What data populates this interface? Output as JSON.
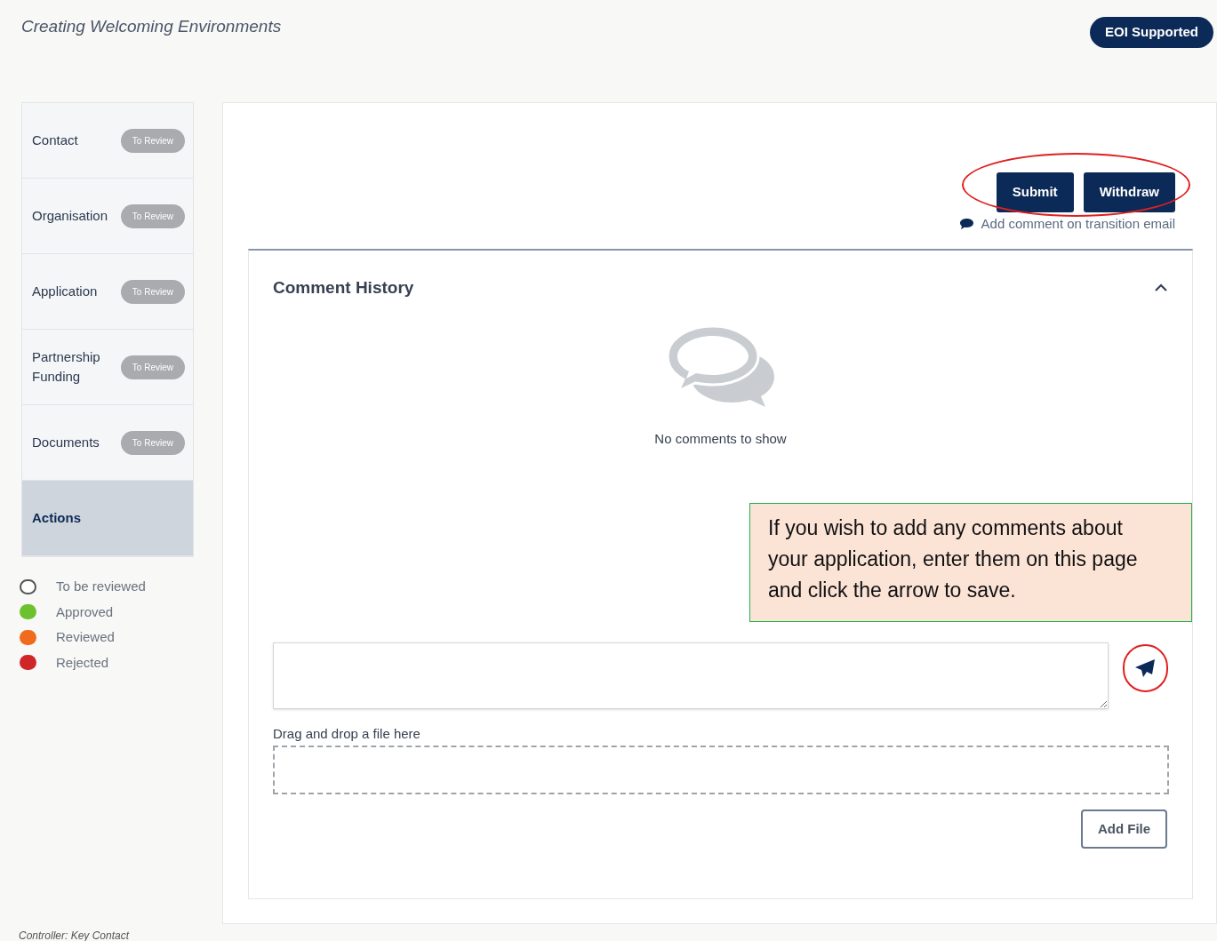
{
  "header": {
    "title": "Creating Welcoming Environments",
    "status_badge": "EOI Supported"
  },
  "sidebar": {
    "items": [
      {
        "label": "Contact",
        "badge": "To Review",
        "selected": false
      },
      {
        "label": "Organisation",
        "badge": "To Review",
        "selected": false
      },
      {
        "label": "Application",
        "badge": "To Review",
        "selected": false
      },
      {
        "label": "Partnership Funding",
        "badge": "To Review",
        "selected": false
      },
      {
        "label": "Documents",
        "badge": "To Review",
        "selected": false
      },
      {
        "label": "Actions",
        "selected": true
      }
    ],
    "legend": [
      {
        "label": "To be reviewed",
        "kind": "outline",
        "color": "#ffffff"
      },
      {
        "label": "Approved",
        "kind": "filled",
        "color": "#6cc12e"
      },
      {
        "label": "Reviewed",
        "kind": "filled",
        "color": "#f26a1b"
      },
      {
        "label": "Rejected",
        "kind": "filled",
        "color": "#d0262a"
      }
    ]
  },
  "actions": {
    "buttons": [
      "Submit",
      "Withdraw"
    ],
    "comment_link": "Add comment on transition email"
  },
  "comment_history": {
    "title": "Comment History",
    "expanded": true,
    "empty_text": "No comments to show",
    "drop_label": "Drag and drop a file here",
    "add_file_button": "Add File"
  },
  "callout": {
    "text": "If you wish to add any comments about your application, enter them on this page and click the arrow to save."
  },
  "footer": {
    "text": "Controller: Key Contact"
  }
}
